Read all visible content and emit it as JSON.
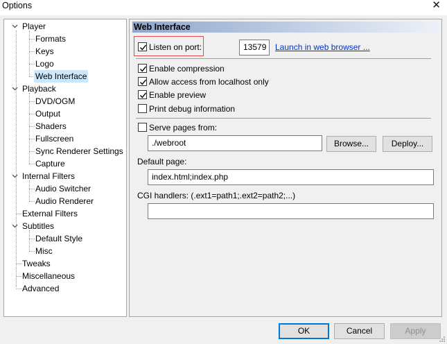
{
  "window": {
    "title": "Options",
    "close_glyph": "✕"
  },
  "tree": {
    "player": "Player",
    "player_children": [
      "Formats",
      "Keys",
      "Logo",
      "Web Interface"
    ],
    "playback": "Playback",
    "playback_children": [
      "DVD/OGM",
      "Output",
      "Shaders",
      "Fullscreen",
      "Sync Renderer Settings",
      "Capture"
    ],
    "internal_filters": "Internal Filters",
    "internal_filters_children": [
      "Audio Switcher",
      "Audio Renderer"
    ],
    "external_filters": "External Filters",
    "subtitles": "Subtitles",
    "subtitles_children": [
      "Default Style",
      "Misc"
    ],
    "tweaks": "Tweaks",
    "miscellaneous": "Miscellaneous",
    "advanced": "Advanced",
    "selected": "Web Interface"
  },
  "panel": {
    "header": "Web Interface",
    "listen_label": "Listen on port:",
    "listen_checked": true,
    "port": "13579",
    "launch_link": "Launch in web browser ...",
    "enable_compression": "Enable compression",
    "enable_compression_checked": true,
    "allow_localhost": "Allow access from localhost only",
    "allow_localhost_checked": true,
    "enable_preview": "Enable preview",
    "enable_preview_checked": true,
    "print_debug": "Print debug information",
    "print_debug_checked": false,
    "serve_pages": "Serve pages from:",
    "serve_pages_checked": false,
    "webroot": "./webroot",
    "browse_btn": "Browse...",
    "deploy_btn": "Deploy...",
    "default_page_label": "Default page:",
    "default_page_value": "index.html;index.php",
    "cgi_label": "CGI handlers: (.ext1=path1;.ext2=path2;...)",
    "cgi_value": ""
  },
  "buttons": {
    "ok": "OK",
    "cancel": "Cancel",
    "apply": "Apply"
  },
  "colors": {
    "highlight_border": "#e0474f",
    "selection": "#cce8ff",
    "link": "#0033cc",
    "default_button_border": "#0078d7"
  }
}
